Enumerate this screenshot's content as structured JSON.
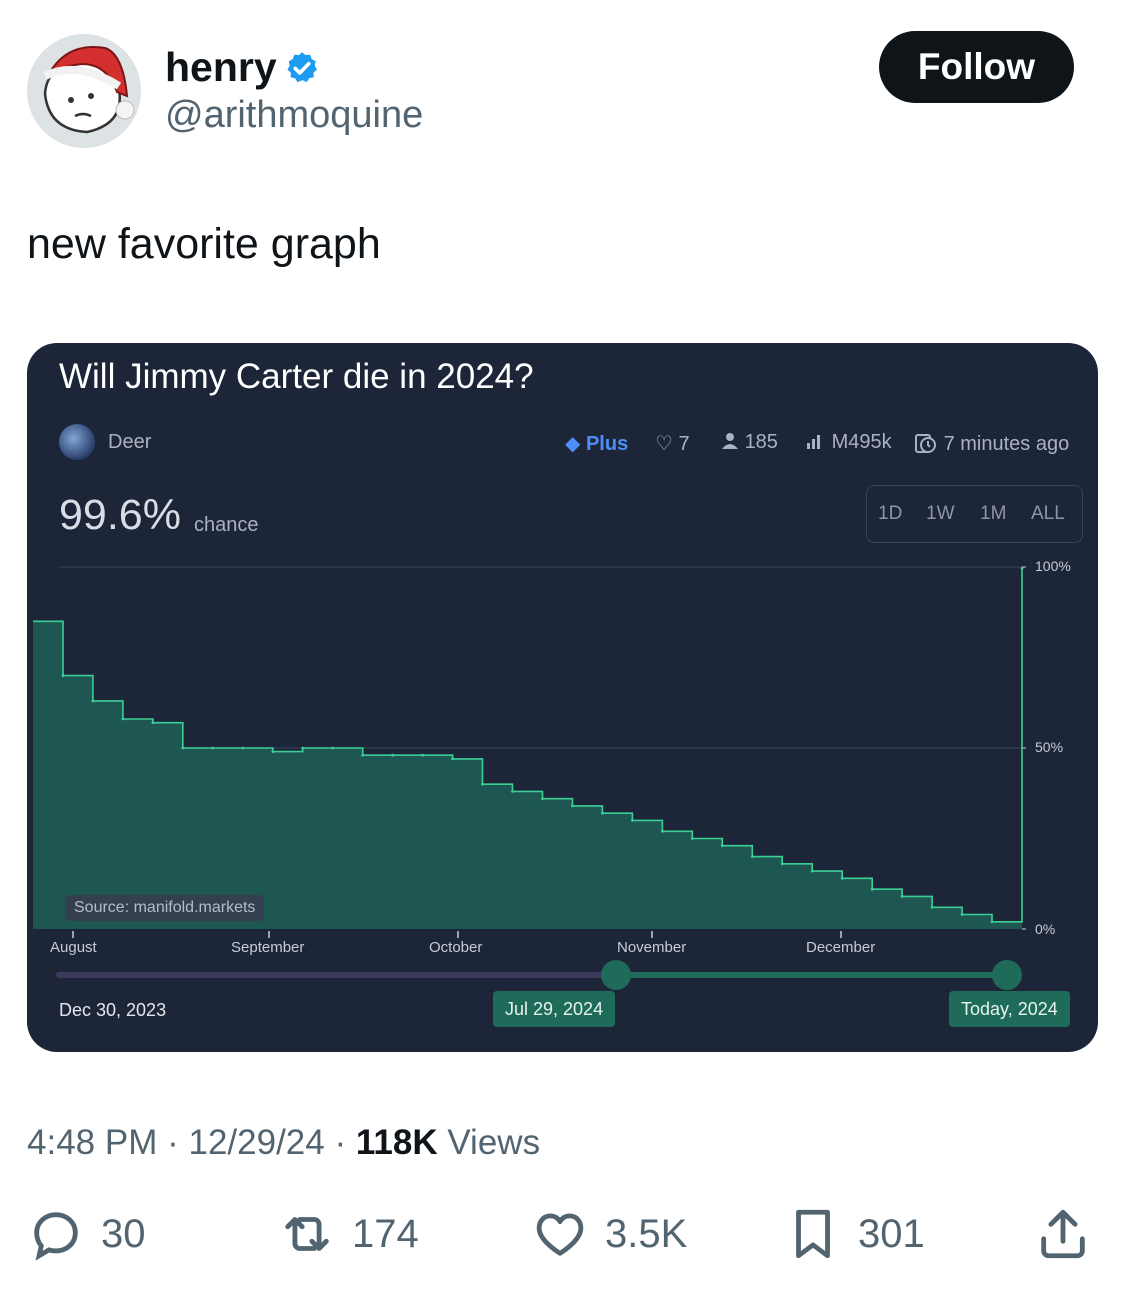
{
  "tweet": {
    "author": "henry",
    "handle": "@arithmoquine",
    "follow_label": "Follow",
    "text": "new favorite graph",
    "time": "4:48 PM",
    "sep1": "·",
    "date": "12/29/24",
    "sep2": "·",
    "views_count": "118K",
    "views_label": "Views",
    "replies": "30",
    "retweets": "174",
    "likes": "3.5K",
    "bookmarks": "301"
  },
  "market": {
    "question": "Will Jimmy Carter die in 2024?",
    "creator": "Deer",
    "plus_label": "Plus",
    "likes": "7",
    "traders": "185",
    "volume": "M495k",
    "updated": "7 minutes ago",
    "probability": "99.6%",
    "probability_label": "chance",
    "ranges": [
      "1D",
      "1W",
      "1M",
      "ALL"
    ],
    "source": "Source: manifold.markets",
    "slider_start": "Dec 30, 2023",
    "slider_mid": "Jul 29, 2024",
    "slider_end": "Today, 2024"
  },
  "chart_data": {
    "type": "area",
    "title": "Will Jimmy Carter die in 2024?",
    "x": [
      "Jul 29",
      "Aug 1",
      "Aug 5",
      "Aug 10",
      "Aug 15",
      "Aug 20",
      "Aug 25",
      "Sep 1",
      "Sep 5",
      "Sep 10",
      "Sep 15",
      "Sep 20",
      "Sep 25",
      "Oct 1",
      "Oct 3",
      "Oct 5",
      "Oct 8",
      "Oct 15",
      "Oct 20",
      "Oct 25",
      "Nov 1",
      "Nov 5",
      "Nov 10",
      "Nov 15",
      "Nov 20",
      "Nov 25",
      "Dec 1",
      "Dec 5",
      "Dec 10",
      "Dec 15",
      "Dec 20",
      "Dec 25",
      "Dec 28",
      "Dec 29"
    ],
    "values": [
      85,
      70,
      63,
      58,
      57,
      50,
      50,
      50,
      49,
      50,
      50,
      48,
      48,
      48,
      47,
      40,
      38,
      36,
      34,
      32,
      30,
      27,
      25,
      23,
      20,
      18,
      16,
      14,
      11,
      9,
      6,
      4,
      2,
      99.6
    ],
    "x_ticks": [
      "August",
      "September",
      "October",
      "November",
      "December"
    ],
    "y_ticks": [
      "100%",
      "50%",
      "0%"
    ],
    "ylim": [
      0,
      100
    ],
    "grid": true,
    "color": "#2ea57c"
  },
  "colors": {
    "card_bg": "#1d2639",
    "line": "#3ccf95",
    "fill": "#1f5d54",
    "slider_track": "#3b3a5c",
    "slider_active": "#1e6b5a",
    "verified": "#1d9bf0"
  }
}
